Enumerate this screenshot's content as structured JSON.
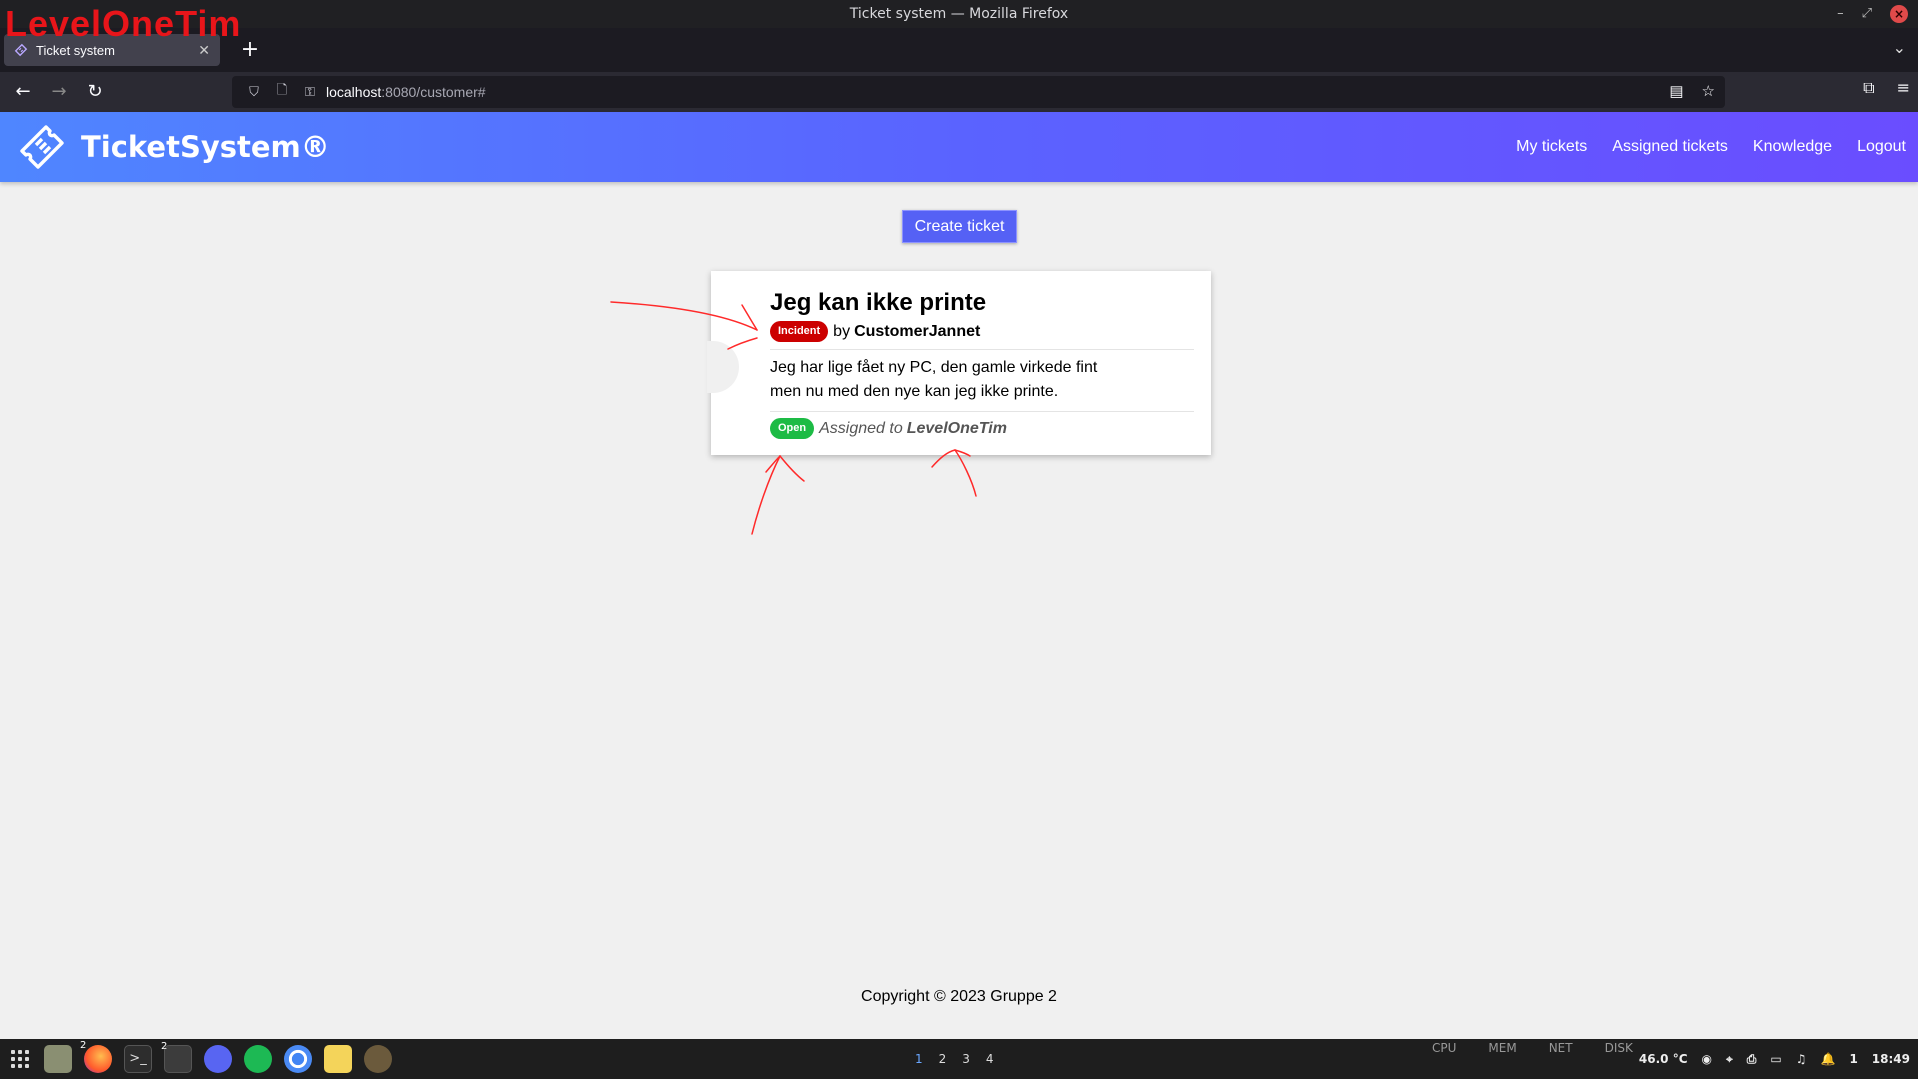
{
  "window": {
    "title": "Ticket system — Mozilla Firefox",
    "watermark": "LevelOneTim"
  },
  "browser": {
    "tab_title": "Ticket system",
    "tab_close": "✕",
    "new_tab": "+",
    "url_host": "localhost",
    "url_path": ":8080/customer#"
  },
  "app": {
    "brand": "TicketSystem®",
    "nav": [
      "My tickets",
      "Assigned tickets",
      "Knowledge",
      "Logout"
    ],
    "create_button": "Create ticket",
    "accent_color": "#5561f5"
  },
  "ticket": {
    "title": "Jeg kan ikke printe",
    "type_badge": "Incident",
    "by_label": "by",
    "author": "CustomerJannet",
    "description": "Jeg har lige fået ny PC, den gamle virkede fint men nu med den nye kan jeg ikke printe.",
    "status_badge": "Open",
    "assigned_label": "Assigned to",
    "assignee": "LevelOneTim",
    "type_color": "#cc0000",
    "status_color": "#1dbb45"
  },
  "footer": "Copyright © 2023 Gruppe 2",
  "taskbar": {
    "workspaces": [
      "1",
      "2",
      "3",
      "4"
    ],
    "active_workspace": "1",
    "stats": [
      "CPU",
      "MEM",
      "NET",
      "DISK"
    ],
    "temperature": "46.0 °C",
    "tray_count": "1",
    "clock": "18:49",
    "badge_firefox": "2",
    "badge_terminal": "2"
  }
}
